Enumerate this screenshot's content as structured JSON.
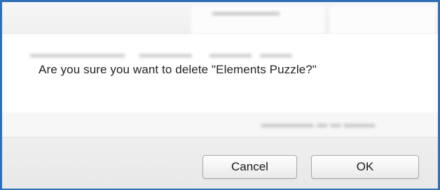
{
  "dialog": {
    "message": "Are you sure you want to delete \"Elements Puzzle?\"",
    "cancel_label": "Cancel",
    "ok_label": "OK"
  },
  "colors": {
    "frame_border": "#2f6fb8",
    "button_bar": "#ececec"
  }
}
